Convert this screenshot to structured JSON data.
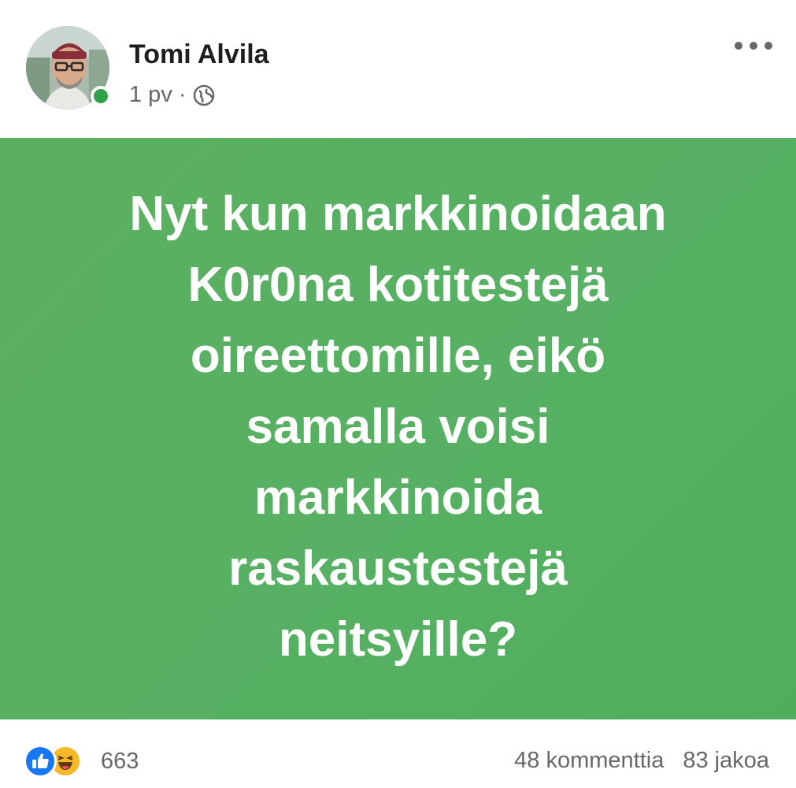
{
  "post": {
    "author": "Tomi Alvila",
    "time": "1 pv",
    "separator": "·",
    "audience_icon": "globe-icon",
    "more_icon": "more-horizontal-icon",
    "online_status": "online",
    "background_color": "#57b063",
    "text_color": "#ffffff",
    "status_lines": [
      "Nyt kun markkinoidaan",
      "K0r0na kotitestejä",
      "oireettomille, eikö",
      "samalla voisi",
      "markkinoida",
      "raskaustestejä",
      "neitsyille?"
    ]
  },
  "footer": {
    "reaction_icons": [
      "like-icon",
      "haha-icon"
    ],
    "reaction_count": "663",
    "comments": "48 kommenttia",
    "shares": "83 jakoa"
  },
  "colors": {
    "like": "#1877f2",
    "haha": "#f7b928",
    "online": "#31a24c",
    "secondary_text": "#65676b"
  }
}
